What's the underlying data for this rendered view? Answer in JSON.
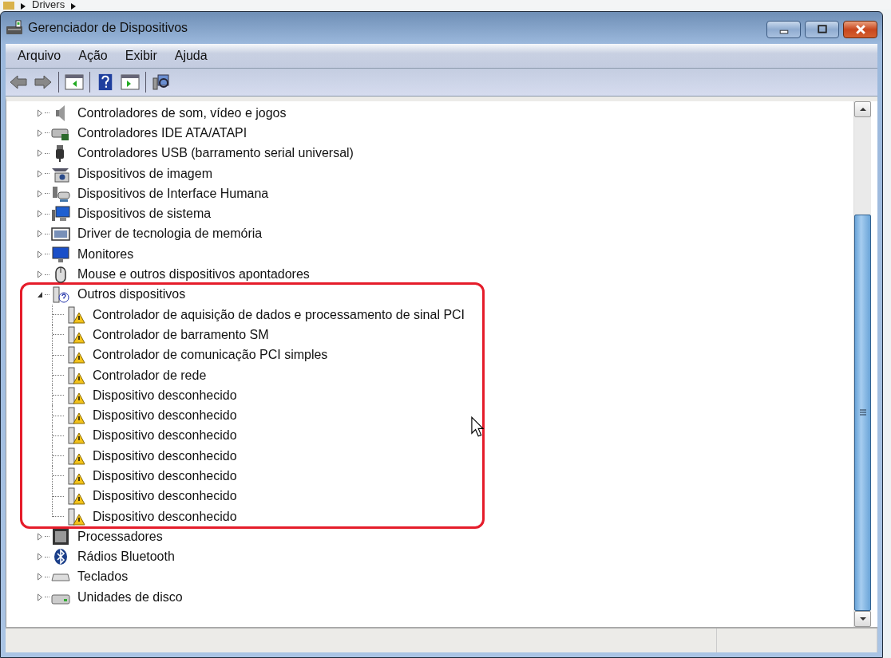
{
  "breadcrumb": {
    "path": [
      "Drivers"
    ]
  },
  "window": {
    "title": "Gerenciador de Dispositivos"
  },
  "menu": [
    "Arquivo",
    "Ação",
    "Exibir",
    "Ajuda"
  ],
  "tree": [
    {
      "label": "Controladores de som, vídeo e jogos",
      "expanded": false,
      "highlighted": false
    },
    {
      "label": "Controladores IDE ATA/ATAPI",
      "expanded": false,
      "highlighted": false
    },
    {
      "label": "Controladores USB (barramento serial universal)",
      "expanded": false,
      "highlighted": false
    },
    {
      "label": "Dispositivos de imagem",
      "expanded": false,
      "highlighted": false
    },
    {
      "label": "Dispositivos de Interface Humana",
      "expanded": false,
      "highlighted": false
    },
    {
      "label": "Dispositivos de sistema",
      "expanded": false,
      "highlighted": false
    },
    {
      "label": "Driver de tecnologia de memória",
      "expanded": false,
      "highlighted": false
    },
    {
      "label": "Monitores",
      "expanded": false,
      "highlighted": false
    },
    {
      "label": "Mouse e outros dispositivos apontadores",
      "expanded": false,
      "highlighted": false
    },
    {
      "label": "Outros dispositivos",
      "expanded": true,
      "highlighted": true,
      "children": [
        {
          "label": "Controlador de aquisição de dados e processamento de sinal PCI"
        },
        {
          "label": "Controlador de barramento SM"
        },
        {
          "label": "Controlador de comunicação PCI simples"
        },
        {
          "label": "Controlador de rede"
        },
        {
          "label": "Dispositivo desconhecido"
        },
        {
          "label": "Dispositivo desconhecido"
        },
        {
          "label": "Dispositivo desconhecido"
        },
        {
          "label": "Dispositivo desconhecido"
        },
        {
          "label": "Dispositivo desconhecido"
        },
        {
          "label": "Dispositivo desconhecido"
        },
        {
          "label": "Dispositivo desconhecido"
        }
      ]
    },
    {
      "label": "Processadores",
      "expanded": false,
      "highlighted": false
    },
    {
      "label": "Rádios Bluetooth",
      "expanded": false,
      "highlighted": false
    },
    {
      "label": "Teclados",
      "expanded": false,
      "highlighted": false
    },
    {
      "label": "Unidades de disco",
      "expanded": false,
      "highlighted": false
    }
  ]
}
